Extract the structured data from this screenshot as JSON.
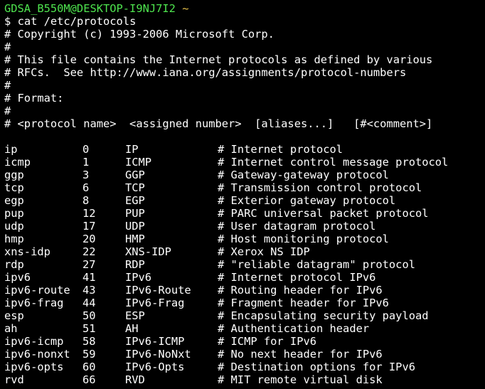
{
  "prompt": {
    "user_host": "GDSA_B550M@DESKTOP-I9NJ7I2",
    "path": "~",
    "symbol": "$",
    "command": "cat /etc/protocols"
  },
  "header_comments": [
    "# Copyright (c) 1993-2006 Microsoft Corp.",
    "#",
    "# This file contains the Internet protocols as defined by various",
    "# RFCs.  See http://www.iana.org/assignments/protocol-numbers",
    "#",
    "# Format:",
    "#",
    "# <protocol name>  <assigned number>  [aliases...]   [#<comment>]"
  ],
  "protocols": [
    {
      "name": "ip",
      "number": "0",
      "alias": "IP",
      "comment": "# Internet protocol"
    },
    {
      "name": "icmp",
      "number": "1",
      "alias": "ICMP",
      "comment": "# Internet control message protocol"
    },
    {
      "name": "ggp",
      "number": "3",
      "alias": "GGP",
      "comment": "# Gateway-gateway protocol"
    },
    {
      "name": "tcp",
      "number": "6",
      "alias": "TCP",
      "comment": "# Transmission control protocol"
    },
    {
      "name": "egp",
      "number": "8",
      "alias": "EGP",
      "comment": "# Exterior gateway protocol"
    },
    {
      "name": "pup",
      "number": "12",
      "alias": "PUP",
      "comment": "# PARC universal packet protocol"
    },
    {
      "name": "udp",
      "number": "17",
      "alias": "UDP",
      "comment": "# User datagram protocol"
    },
    {
      "name": "hmp",
      "number": "20",
      "alias": "HMP",
      "comment": "# Host monitoring protocol"
    },
    {
      "name": "xns-idp",
      "number": "22",
      "alias": "XNS-IDP",
      "comment": "# Xerox NS IDP"
    },
    {
      "name": "rdp",
      "number": "27",
      "alias": "RDP",
      "comment": "# \"reliable datagram\" protocol"
    },
    {
      "name": "ipv6",
      "number": "41",
      "alias": "IPv6",
      "comment": "# Internet protocol IPv6"
    },
    {
      "name": "ipv6-route",
      "number": "43",
      "alias": "IPv6-Route",
      "comment": "# Routing header for IPv6"
    },
    {
      "name": "ipv6-frag",
      "number": "44",
      "alias": "IPv6-Frag",
      "comment": "# Fragment header for IPv6"
    },
    {
      "name": "esp",
      "number": "50",
      "alias": "ESP",
      "comment": "# Encapsulating security payload"
    },
    {
      "name": "ah",
      "number": "51",
      "alias": "AH",
      "comment": "# Authentication header"
    },
    {
      "name": "ipv6-icmp",
      "number": "58",
      "alias": "IPv6-ICMP",
      "comment": "# ICMP for IPv6"
    },
    {
      "name": "ipv6-nonxt",
      "number": "59",
      "alias": "IPv6-NoNxt",
      "comment": "# No next header for IPv6"
    },
    {
      "name": "ipv6-opts",
      "number": "60",
      "alias": "IPv6-Opts",
      "comment": "# Destination options for IPv6"
    },
    {
      "name": "rvd",
      "number": "66",
      "alias": "RVD",
      "comment": "# MIT remote virtual disk"
    }
  ]
}
